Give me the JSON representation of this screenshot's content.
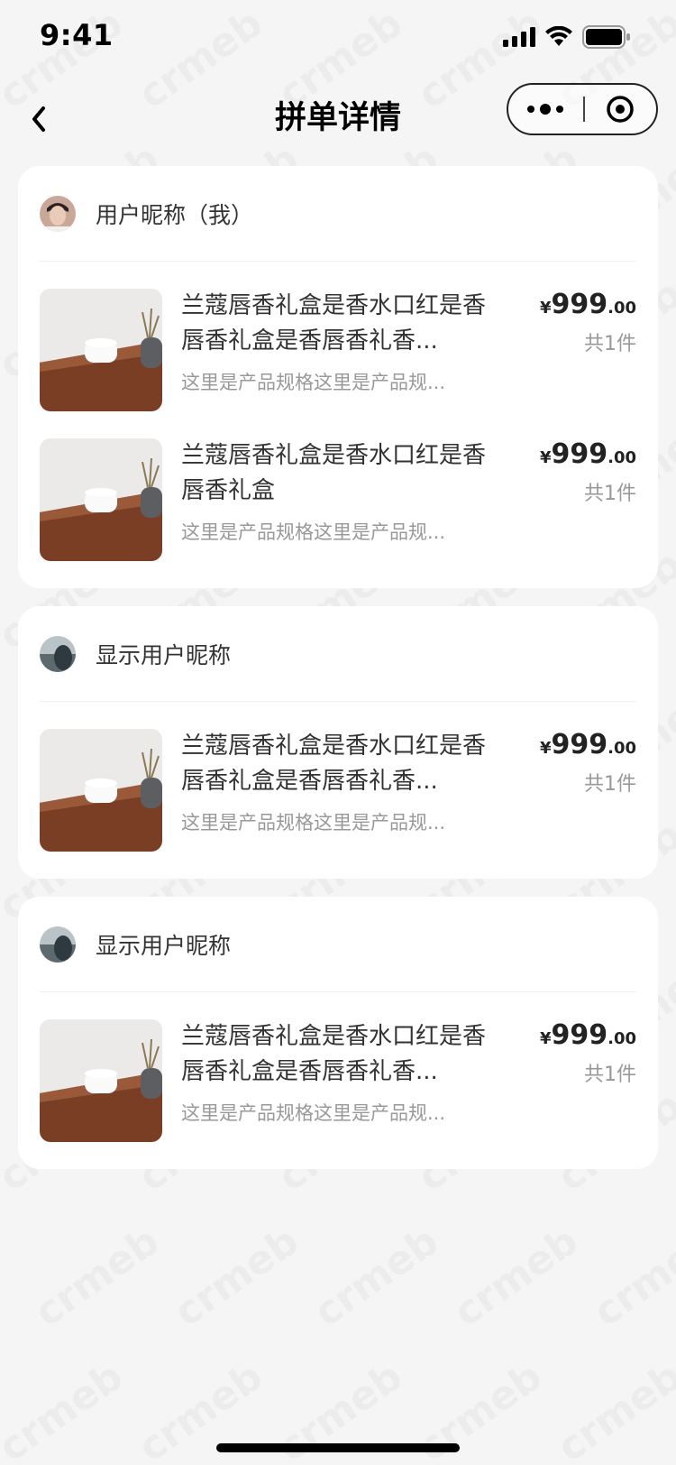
{
  "status": {
    "time": "9:41"
  },
  "nav": {
    "title": "拼单详情"
  },
  "watermark": "crmeb",
  "groups": [
    {
      "user": "用户昵称（我）",
      "items": [
        {
          "name": "兰蔻唇香礼盒是香水口红是香唇香礼盒是香唇香礼香...",
          "spec": "这里是产品规格这里是产品规...",
          "price_symbol": "¥",
          "price_int": "999",
          "price_dec": ".00",
          "qty": "共1件"
        },
        {
          "name": "兰蔻唇香礼盒是香水口红是香唇香礼盒",
          "spec": "这里是产品规格这里是产品规...",
          "price_symbol": "¥",
          "price_int": "999",
          "price_dec": ".00",
          "qty": "共1件"
        }
      ]
    },
    {
      "user": "显示用户昵称",
      "items": [
        {
          "name": "兰蔻唇香礼盒是香水口红是香唇香礼盒是香唇香礼香...",
          "spec": "这里是产品规格这里是产品规...",
          "price_symbol": "¥",
          "price_int": "999",
          "price_dec": ".00",
          "qty": "共1件"
        }
      ]
    },
    {
      "user": "显示用户昵称",
      "items": [
        {
          "name": "兰蔻唇香礼盒是香水口红是香唇香礼盒是香唇香礼香...",
          "spec": "这里是产品规格这里是产品规...",
          "price_symbol": "¥",
          "price_int": "999",
          "price_dec": ".00",
          "qty": "共1件"
        }
      ]
    }
  ]
}
